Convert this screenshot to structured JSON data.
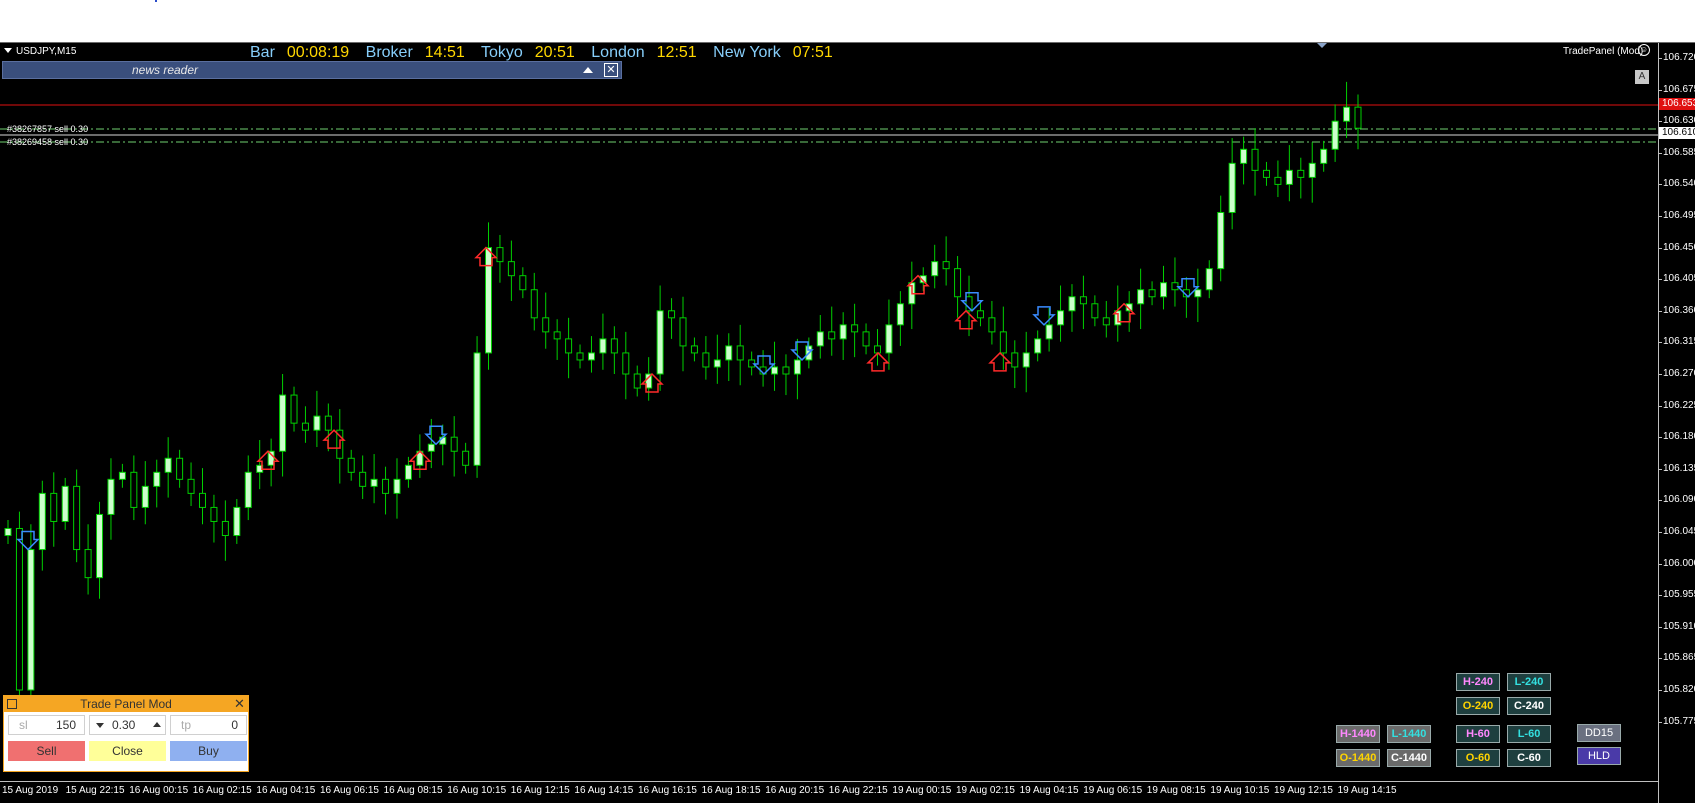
{
  "window": {
    "symbol": "USDJPY,M15"
  },
  "clock": {
    "items": [
      {
        "label": "Bar",
        "value": "00:08:19"
      },
      {
        "label": "Broker",
        "value": "14:51"
      },
      {
        "label": "Tokyo",
        "value": "20:51"
      },
      {
        "label": "London",
        "value": "12:51"
      },
      {
        "label": "New York",
        "value": "07:51"
      }
    ]
  },
  "news_reader": {
    "title": "news reader",
    "close_glyph": "✕"
  },
  "trade_panel_label": {
    "text": "TradePanel (Mod)",
    "icon": "smiley-icon"
  },
  "a_button": {
    "label": "A"
  },
  "orders": [
    {
      "label": "#38267857 sell 0.30"
    },
    {
      "label": "#38269458 sell 0.30"
    }
  ],
  "price_axis": {
    "ticks": [
      "106.720",
      "106.675",
      "106.630",
      "106.585",
      "106.540",
      "106.495",
      "106.450",
      "106.405",
      "106.360",
      "106.315",
      "106.270",
      "106.225",
      "106.180",
      "106.135",
      "106.090",
      "106.045",
      "106.000",
      "105.955",
      "105.910",
      "105.865",
      "105.820",
      "105.775"
    ],
    "ask_price": "106.653",
    "bid_price": "106.610",
    "ask_color": "#e01010"
  },
  "time_axis": {
    "ticks": [
      "15 Aug 2019",
      "15 Aug 22:15",
      "16 Aug 00:15",
      "16 Aug 02:15",
      "16 Aug 04:15",
      "16 Aug 06:15",
      "16 Aug 08:15",
      "16 Aug 10:15",
      "16 Aug 12:15",
      "16 Aug 14:15",
      "16 Aug 16:15",
      "16 Aug 18:15",
      "16 Aug 20:15",
      "16 Aug 22:15",
      "19 Aug 00:15",
      "19 Aug 02:15",
      "19 Aug 04:15",
      "19 Aug 06:15",
      "19 Aug 08:15",
      "19 Aug 10:15",
      "19 Aug 12:15",
      "19 Aug 14:15"
    ]
  },
  "tf_buttons": [
    {
      "label": "H-240",
      "fg": "#ff88ff",
      "bg": "#1e3f3f"
    },
    {
      "label": "L-240",
      "fg": "#33e0e0",
      "bg": "#1e3f3f"
    },
    {
      "label": "O-240",
      "fg": "#ffd400",
      "bg": "#1e3f3f"
    },
    {
      "label": "C-240",
      "fg": "#ffffff",
      "bg": "#1e3f3f"
    },
    {
      "label": "H-1440",
      "fg": "#ff88ff",
      "bg": "#6a6a6a"
    },
    {
      "label": "L-1440",
      "fg": "#33e0e0",
      "bg": "#6a6a6a"
    },
    {
      "label": "O-1440",
      "fg": "#ffd400",
      "bg": "#6a6a6a"
    },
    {
      "label": "C-1440",
      "fg": "#ffffff",
      "bg": "#6a6a6a"
    },
    {
      "label": "H-60",
      "fg": "#ff88ff",
      "bg": "#1e3f3f"
    },
    {
      "label": "L-60",
      "fg": "#33e0e0",
      "bg": "#1e3f3f"
    },
    {
      "label": "O-60",
      "fg": "#ffd400",
      "bg": "#1e3f3f"
    },
    {
      "label": "C-60",
      "fg": "#ffffff",
      "bg": "#1e3f3f"
    },
    {
      "label": "DD15",
      "fg": "#ffffff",
      "bg": "#6a7080"
    },
    {
      "label": "HLD",
      "fg": "#ffffff",
      "bg": "#4a3aa8"
    }
  ],
  "trade_panel": {
    "title": "Trade Panel Mod",
    "close_glyph": "✕",
    "sl_label": "sl",
    "sl_value": "150",
    "lot_value": "0.30",
    "tp_label": "tp",
    "tp_value": "0",
    "sell_label": "Sell",
    "close_label": "Close",
    "buy_label": "Buy",
    "sell_color": "#f07070",
    "close_color": "#ffff99",
    "buy_color": "#8fb0f0"
  },
  "chart_colors": {
    "bull": "#ccffcc",
    "bear": "#000000",
    "wick": "#00d000",
    "grid_order": "#6fd06f",
    "ask_line": "#e01010"
  },
  "chart_data": {
    "type": "candlestick",
    "symbol": "USDJPY,M15",
    "ylim": [
      105.775,
      106.74
    ],
    "close": [
      106.05,
      105.82,
      106.02,
      106.1,
      106.06,
      106.11,
      106.02,
      105.98,
      106.07,
      106.12,
      106.13,
      106.08,
      106.11,
      106.13,
      106.15,
      106.12,
      106.1,
      106.08,
      106.06,
      106.04,
      106.08,
      106.13,
      106.14,
      106.16,
      106.24,
      106.2,
      106.19,
      106.21,
      106.19,
      106.15,
      106.13,
      106.11,
      106.12,
      106.1,
      106.12,
      106.14,
      106.16,
      106.17,
      106.18,
      106.16,
      106.14,
      106.3,
      106.45,
      106.43,
      106.41,
      106.39,
      106.35,
      106.33,
      106.32,
      106.3,
      106.29,
      106.3,
      106.32,
      106.3,
      106.27,
      106.25,
      106.27,
      106.36,
      106.35,
      106.31,
      106.3,
      106.28,
      106.29,
      106.31,
      106.29,
      106.28,
      106.27,
      106.28,
      106.27,
      106.29,
      106.31,
      106.33,
      106.32,
      106.34,
      106.33,
      106.31,
      106.3,
      106.34,
      106.37,
      106.4,
      106.41,
      106.43,
      106.42,
      106.38,
      106.36,
      106.35,
      106.33,
      106.3,
      106.28,
      106.3,
      106.32,
      106.34,
      106.36,
      106.38,
      106.37,
      106.35,
      106.34,
      106.36,
      106.37,
      106.39,
      106.38,
      106.4,
      106.39,
      106.38,
      106.39,
      106.42,
      106.5,
      106.57,
      106.59,
      106.56,
      106.55,
      106.54,
      106.56,
      106.55,
      106.57,
      106.59,
      106.63,
      106.65,
      106.62
    ]
  }
}
